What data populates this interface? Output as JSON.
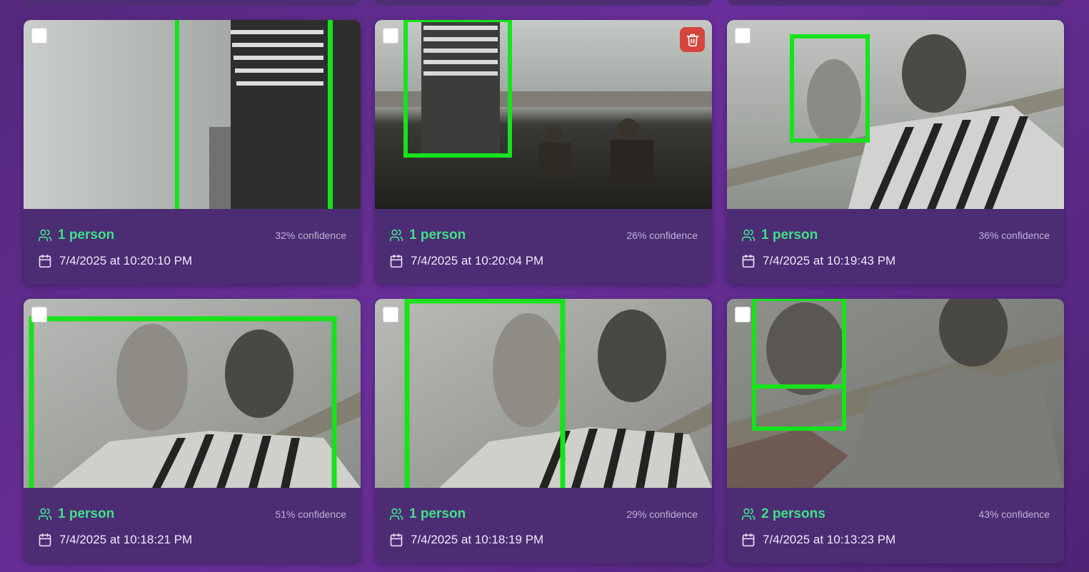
{
  "colors": {
    "count_text": "#3fe08a",
    "box": "#16e31b",
    "card_bg": "#4c2c73",
    "delete_bg": "#d6453d"
  },
  "cards": [
    {
      "count": "1 person",
      "confidence": "32% confidence",
      "timestamp": "7/4/2025 at 10:20:10 PM",
      "icon": "users-icon",
      "date_icon": "calendar-icon"
    },
    {
      "count": "1 person",
      "confidence": "26% confidence",
      "timestamp": "7/4/2025 at 10:20:04 PM",
      "icon": "users-icon",
      "date_icon": "calendar-icon",
      "delete_icon": "trash-icon"
    },
    {
      "count": "1 person",
      "confidence": "36% confidence",
      "timestamp": "7/4/2025 at 10:19:43 PM",
      "icon": "users-icon",
      "date_icon": "calendar-icon"
    },
    {
      "count": "1 person",
      "confidence": "51% confidence",
      "timestamp": "7/4/2025 at 10:18:21 PM",
      "icon": "users-icon",
      "date_icon": "calendar-icon"
    },
    {
      "count": "1 person",
      "confidence": "29% confidence",
      "timestamp": "7/4/2025 at 10:18:19 PM",
      "icon": "users-icon",
      "date_icon": "calendar-icon"
    },
    {
      "count": "2 persons",
      "confidence": "43% confidence",
      "timestamp": "7/4/2025 at 10:13:23 PM",
      "icon": "users-icon",
      "date_icon": "calendar-icon"
    }
  ]
}
